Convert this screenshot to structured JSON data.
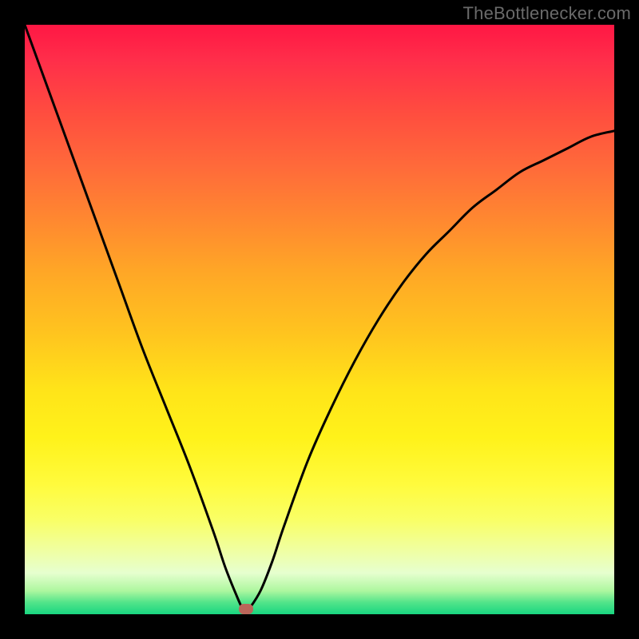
{
  "watermark": "TheBottlenecker.com",
  "chart_data": {
    "type": "line",
    "title": "",
    "xlabel": "",
    "ylabel": "",
    "xlim": [
      0,
      100
    ],
    "ylim": [
      0,
      100
    ],
    "x": [
      0,
      4,
      8,
      12,
      16,
      20,
      24,
      28,
      32,
      34,
      36,
      37,
      37.5,
      38,
      40,
      42,
      44,
      48,
      52,
      56,
      60,
      64,
      68,
      72,
      76,
      80,
      84,
      88,
      92,
      96,
      100
    ],
    "values": [
      100,
      89,
      78,
      67,
      56,
      45,
      35,
      25,
      14,
      8,
      3,
      0.8,
      0.2,
      0.8,
      4,
      9,
      15,
      26,
      35,
      43,
      50,
      56,
      61,
      65,
      69,
      72,
      75,
      77,
      79,
      81,
      82
    ],
    "gradient_stops": [
      {
        "pos": 0,
        "color": "#ff1744"
      },
      {
        "pos": 50,
        "color": "#ffe419"
      },
      {
        "pos": 100,
        "color": "#18d680"
      }
    ],
    "marker": {
      "x": 37.5,
      "y": 0.2
    }
  }
}
